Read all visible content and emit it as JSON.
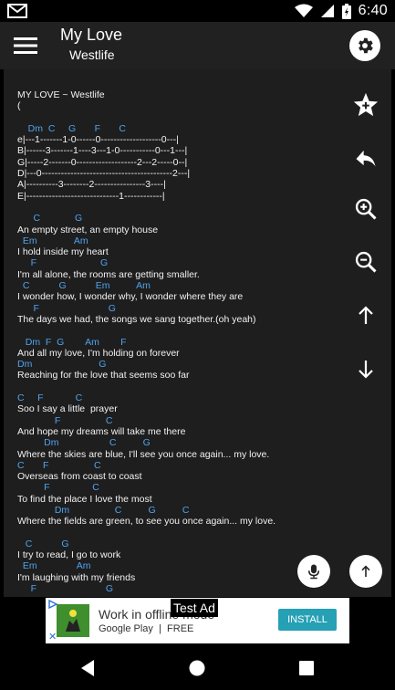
{
  "status_bar": {
    "time": "6:40",
    "icons": [
      "gmail-icon",
      "wifi-icon",
      "signal-icon",
      "battery-icon"
    ]
  },
  "app_bar": {
    "title": "My Love",
    "subtitle": "Westlife",
    "menu_icon": "hamburger-menu-icon",
    "settings_icon": "gear-icon"
  },
  "tab_lines": [
    {
      "t": "MY LOVE ~ Westlife",
      "k": "text"
    },
    {
      "t": "(",
      "k": "text"
    },
    {
      "t": "",
      "k": "gap"
    },
    {
      "t": "    Dm  C     G       F       C",
      "k": "chord"
    },
    {
      "t": "e|---1-------1-0------0-------------------0---|",
      "k": "text"
    },
    {
      "t": "B|------3-------1----3---1-0-----------0---1---|",
      "k": "text"
    },
    {
      "t": "G|-----2-------0-------------------2---2-----0--|",
      "k": "text"
    },
    {
      "t": "D|---0-----------------------------------------2---|",
      "k": "text"
    },
    {
      "t": "A|----------3--------2----------------3----|",
      "k": "text"
    },
    {
      "t": "E|-----------------------------1------------|",
      "k": "text"
    },
    {
      "t": "",
      "k": "gap"
    },
    {
      "t": "      C             G",
      "k": "chord"
    },
    {
      "t": "An empty street, an empty house",
      "k": "text"
    },
    {
      "t": "  Em              Am",
      "k": "chord"
    },
    {
      "t": "I hold inside my heart",
      "k": "text"
    },
    {
      "t": "     F                        G",
      "k": "chord"
    },
    {
      "t": "I'm all alone, the rooms are getting smaller.",
      "k": "text"
    },
    {
      "t": "  C           G           Em          Am",
      "k": "chord"
    },
    {
      "t": "I wonder how, I wonder why, I wonder where they are",
      "k": "text"
    },
    {
      "t": "      F                          G",
      "k": "chord"
    },
    {
      "t": "The days we had, the songs we sang together.(oh yeah)",
      "k": "text"
    },
    {
      "t": "",
      "k": "gap"
    },
    {
      "t": "   Dm  F  G        Am        F",
      "k": "chord"
    },
    {
      "t": "And all my love, I'm holding on forever",
      "k": "text"
    },
    {
      "t": "Dm                         G",
      "k": "chord"
    },
    {
      "t": "Reaching for the love that seems soo far",
      "k": "text"
    },
    {
      "t": "",
      "k": "gap"
    },
    {
      "t": "C     F            C",
      "k": "chord"
    },
    {
      "t": "Soo I say a little  prayer",
      "k": "text"
    },
    {
      "t": "              F                 C",
      "k": "chord"
    },
    {
      "t": "And hope my dreams will take me there",
      "k": "text"
    },
    {
      "t": "          Dm                   C          G",
      "k": "chord"
    },
    {
      "t": "Where the skies are blue, I'll see you once again... my love.",
      "k": "text"
    },
    {
      "t": "C       F                 C",
      "k": "chord"
    },
    {
      "t": "Overseas from coast to coast",
      "k": "text"
    },
    {
      "t": "          F                C",
      "k": "chord"
    },
    {
      "t": "To find the place I love the most",
      "k": "text"
    },
    {
      "t": "              Dm                 C          G          C",
      "k": "chord"
    },
    {
      "t": "Where the fields are green, to see you once again... my love.",
      "k": "text"
    },
    {
      "t": "",
      "k": "gap"
    },
    {
      "t": "   C           G",
      "k": "chord"
    },
    {
      "t": "I try to read, I go to work",
      "k": "text"
    },
    {
      "t": "  Em               Am",
      "k": "chord"
    },
    {
      "t": "I'm laughing with my friends",
      "k": "text"
    },
    {
      "t": "     F                          G",
      "k": "chord"
    }
  ],
  "sidebar_icons": [
    "star-add-icon",
    "back-arrow-icon",
    "zoom-in-icon",
    "zoom-out-icon",
    "arrow-up-icon",
    "arrow-down-icon"
  ],
  "fab_icons": [
    "microphone-icon",
    "scroll-top-icon"
  ],
  "ad": {
    "label": "Test Ad",
    "title": "Work in offline mode",
    "store": "Google Play",
    "separator": "|",
    "price": "FREE",
    "button": "INSTALL",
    "close": "✕"
  },
  "nav_icons": [
    "back-icon",
    "home-icon",
    "recents-icon"
  ],
  "colors": {
    "chord": "#4fa3f0",
    "background": "#1e1e1e",
    "appbar": "#212121",
    "install": "#26a0b5"
  }
}
